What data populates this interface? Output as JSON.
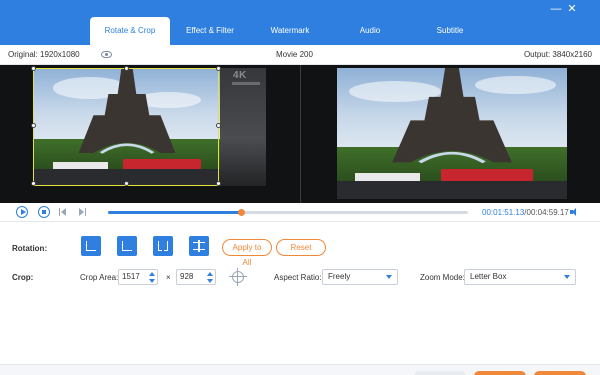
{
  "tabs": [
    {
      "label": "Rotate & Crop",
      "active": true
    },
    {
      "label": "Effect & Filter",
      "active": false
    },
    {
      "label": "Watermark",
      "active": false
    },
    {
      "label": "Audio",
      "active": false
    },
    {
      "label": "Subtitle",
      "active": false
    }
  ],
  "window": {
    "minimize_glyph": "—",
    "close_glyph": "✕"
  },
  "info": {
    "original": "Original: 1920x1080",
    "title": "Movie 200",
    "output": "Output: 3840x2160"
  },
  "preview": {
    "badge": "4K"
  },
  "playback": {
    "current_time": "00:01:51.13",
    "separator": "/",
    "total_time": "00:04:59.17",
    "progress": 0.37
  },
  "rotation": {
    "label": "Rotation:",
    "apply_all": "Apply to All",
    "reset": "Reset"
  },
  "crop": {
    "label": "Crop:",
    "area_label": "Crop Area:",
    "width": "1517",
    "height": "928",
    "times": "×",
    "aspect_label": "Aspect Ratio:",
    "aspect_value": "Freely",
    "zoom_label": "Zoom Mode:",
    "zoom_value": "Letter Box"
  },
  "colors": {
    "accent": "#2f7fe0",
    "orange": "#f0883a",
    "crop_frame": "#e6e23a"
  }
}
